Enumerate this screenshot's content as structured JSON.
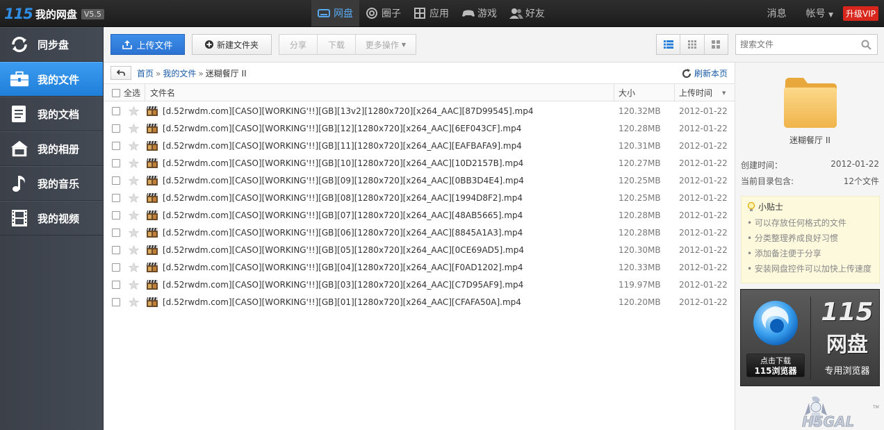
{
  "app": {
    "logo_num": "115",
    "logo_text": "我的网盘",
    "version": "V5.5"
  },
  "topnav": [
    {
      "label": "网盘",
      "icon": "disk-icon",
      "active": true
    },
    {
      "label": "圈子",
      "icon": "circle-icon",
      "active": false
    },
    {
      "label": "应用",
      "icon": "apps-icon",
      "active": false
    },
    {
      "label": "游戏",
      "icon": "gamepad-icon",
      "active": false
    },
    {
      "label": "好友",
      "icon": "friends-icon",
      "active": false
    }
  ],
  "topright": {
    "messages": "消息",
    "account": "帐号",
    "vip": "升级VIP"
  },
  "sidebar": {
    "items": [
      {
        "label": "同步盘",
        "icon": "sync-icon",
        "active": false
      },
      {
        "label": "我的文件",
        "icon": "briefcase-icon",
        "active": true
      },
      {
        "label": "我的文档",
        "icon": "document-icon",
        "active": false
      },
      {
        "label": "我的相册",
        "icon": "photo-album-icon",
        "active": false
      },
      {
        "label": "我的音乐",
        "icon": "music-icon",
        "active": false
      },
      {
        "label": "我的视频",
        "icon": "film-icon",
        "active": false
      }
    ]
  },
  "toolbar": {
    "upload": "上传文件",
    "new_folder": "新建文件夹",
    "share": "分享",
    "download": "下载",
    "more": "更多操作",
    "search_placeholder": "搜索文件"
  },
  "breadcrumb": {
    "home": "首页",
    "my_files": "我的文件",
    "current": "迷糊餐厅 II",
    "sep": "»",
    "refresh": "刷新本页"
  },
  "table": {
    "headers": {
      "select_all": "全选",
      "name": "文件名",
      "size": "大小",
      "date": "上传时间"
    },
    "rows": [
      {
        "name": "[d.52rwdm.com][CASO][WORKING'!!][GB][13v2][1280x720][x264_AAC][87D99545].mp4",
        "size": "120.32MB",
        "date": "2012-01-22"
      },
      {
        "name": "[d.52rwdm.com][CASO][WORKING'!!][GB][12][1280x720][x264_AAC][6EF043CF].mp4",
        "size": "120.28MB",
        "date": "2012-01-22"
      },
      {
        "name": "[d.52rwdm.com][CASO][WORKING'!!][GB][11][1280x720][x264_AAC][EAFBAFA9].mp4",
        "size": "120.31MB",
        "date": "2012-01-22"
      },
      {
        "name": "[d.52rwdm.com][CASO][WORKING'!!][GB][10][1280x720][x264_AAC][10D2157B].mp4",
        "size": "120.27MB",
        "date": "2012-01-22"
      },
      {
        "name": "[d.52rwdm.com][CASO][WORKING'!!][GB][09][1280x720][x264_AAC][0BB3D4E4].mp4",
        "size": "120.25MB",
        "date": "2012-01-22"
      },
      {
        "name": "[d.52rwdm.com][CASO][WORKING'!!][GB][08][1280x720][x264_AAC][1994D8F2].mp4",
        "size": "120.25MB",
        "date": "2012-01-22"
      },
      {
        "name": "[d.52rwdm.com][CASO][WORKING'!!][GB][07][1280x720][x264_AAC][48AB5665].mp4",
        "size": "120.28MB",
        "date": "2012-01-22"
      },
      {
        "name": "[d.52rwdm.com][CASO][WORKING'!!][GB][06][1280x720][x264_AAC][8845A1A3].mp4",
        "size": "120.28MB",
        "date": "2012-01-22"
      },
      {
        "name": "[d.52rwdm.com][CASO][WORKING'!!][GB][05][1280x720][x264_AAC][0CE69AD5].mp4",
        "size": "120.30MB",
        "date": "2012-01-22"
      },
      {
        "name": "[d.52rwdm.com][CASO][WORKING'!!][GB][04][1280x720][x264_AAC][F0AD1202].mp4",
        "size": "120.33MB",
        "date": "2012-01-22"
      },
      {
        "name": "[d.52rwdm.com][CASO][WORKING'!!][GB][03][1280x720][x264_AAC][C7D95AF9].mp4",
        "size": "119.97MB",
        "date": "2012-01-22"
      },
      {
        "name": "[d.52rwdm.com][CASO][WORKING'!!][GB][01][1280x720][x264_AAC][CFAFA50A].mp4",
        "size": "120.20MB",
        "date": "2012-01-22"
      }
    ]
  },
  "details": {
    "folder_name": "迷糊餐厅 II",
    "created_label": "创建时间：",
    "created_value": "2012-01-22",
    "contains_label": "当前目录包含:",
    "contains_value": "12个文件"
  },
  "tips": {
    "title": "小贴士",
    "items": [
      "可以存放任何格式的文件",
      "分类整理养成良好习惯",
      "添加备注便于分享",
      "安装网盘控件可以加快上传速度"
    ]
  },
  "ad": {
    "download_line1": "点击下载",
    "download_line2": "115浏览器",
    "title_num": "115",
    "title_text": "网盘",
    "subtitle": "专用浏览器"
  },
  "colors": {
    "accent": "#2a7fd9",
    "topbar": "#222222",
    "sidebar": "#40454e",
    "vip": "#d9261c"
  }
}
